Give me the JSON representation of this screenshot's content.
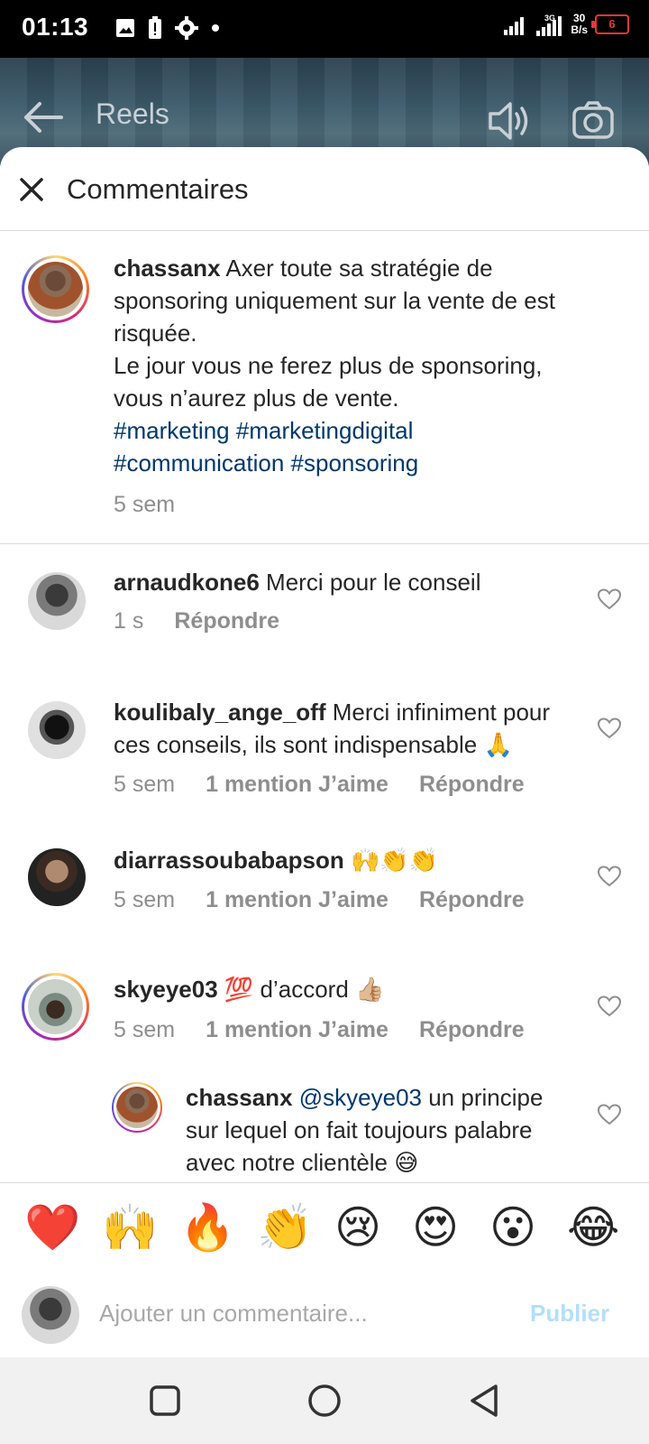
{
  "status_bar": {
    "time": "01:13",
    "net_speed_value": "30",
    "net_speed_unit": "B/s",
    "battery": "6",
    "signal_label": "3G"
  },
  "header": {
    "title": "Reels"
  },
  "sheet": {
    "title": "Commentaires"
  },
  "caption": {
    "username": "chassanx",
    "text_line1": " Axer toute sa stratégie de sponsoring uniquement sur la vente de est risquée.",
    "text_line2": "Le jour vous ne ferez plus de sponsoring, vous n’aurez plus de vente.",
    "hashtags": [
      "#marketing",
      "#marketingdigital",
      "#communication",
      "#sponsoring"
    ],
    "time": "5 sem"
  },
  "comments": [
    {
      "username": "arnaudkone6",
      "text": " Merci pour le conseil",
      "time": "1 s",
      "likes": "",
      "reply": "Répondre"
    },
    {
      "username": "koulibaly_ange_off",
      "text": " Merci infiniment pour ces conseils, ils sont indispensable 🙏",
      "time": "5 sem",
      "likes": "1 mention J’aime",
      "reply": "Répondre"
    },
    {
      "username": "diarrassoubabapson",
      "text": " 🙌👏👏",
      "time": "5 sem",
      "likes": "1 mention J’aime",
      "reply": "Répondre"
    },
    {
      "username": "skyeye03",
      "text": " 💯 d’accord 👍🏼",
      "time": "5 sem",
      "likes": "1 mention J’aime",
      "reply": "Répondre"
    }
  ],
  "reply": {
    "username": "chassanx",
    "mention": " @skyeye03",
    "text": " un principe sur lequel on fait toujours palabre avec notre clientèle 😅"
  },
  "emoji_bar": [
    "❤️",
    "🙌",
    "🔥",
    "👏",
    "😢",
    "😍",
    "😮",
    "😂"
  ],
  "input": {
    "placeholder": "Ajouter un commentaire...",
    "publish_label": "Publier"
  },
  "colors": {
    "hashtag": "#00376b",
    "meta": "#8e8e8e",
    "publish": "#b2dffc",
    "ring_gradient": "#d62976"
  }
}
